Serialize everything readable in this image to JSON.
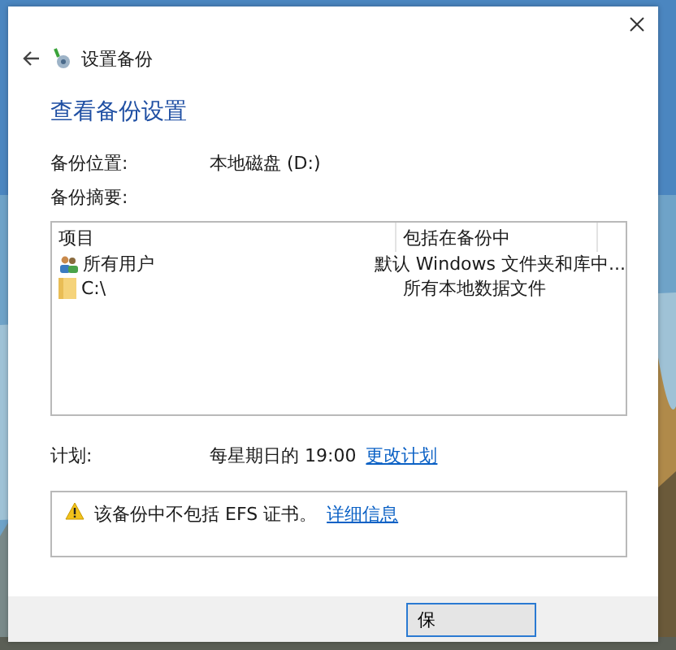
{
  "window": {
    "title": "设置备份"
  },
  "heading": "查看备份设置",
  "location": {
    "label": "备份位置:",
    "value": "本地磁盘 (D:)"
  },
  "summary": {
    "label": "备份摘要:"
  },
  "summary_table": {
    "columns": [
      "项目",
      "包括在备份中"
    ],
    "rows": [
      {
        "kind": "users",
        "item": "所有用户",
        "included": "默认 Windows 文件夹和库中..."
      },
      {
        "kind": "folder",
        "item": "C:\\",
        "included": "所有本地数据文件"
      }
    ]
  },
  "schedule": {
    "label": "计划:",
    "value": "每星期日的 19:00",
    "link": "更改计划"
  },
  "notice": {
    "text": "该备份中不包括 EFS 证书。",
    "link": "详细信息"
  },
  "buttons": [
    "保"
  ]
}
